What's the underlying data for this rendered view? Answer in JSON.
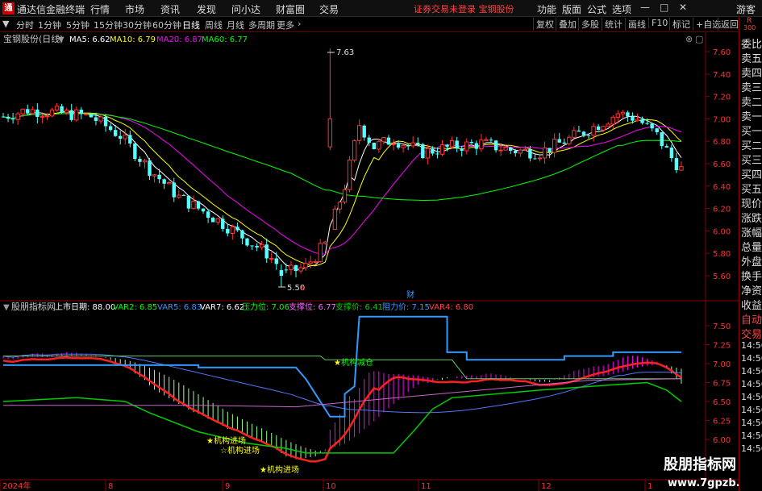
{
  "titlebar": {
    "logo_text": "通",
    "app_title": "通达信金融终端",
    "menus": [
      "行情",
      "市场",
      "资讯",
      "发现",
      "问小达",
      "财富圈",
      "交易"
    ],
    "warning": "证券交易未登录  宝钢股份",
    "right_menus": [
      "功能",
      "版面",
      "公式",
      "选项"
    ],
    "guest_label": "游客"
  },
  "toolbar": {
    "periods": [
      "分时",
      "1分钟",
      "5分钟",
      "15分钟",
      "30分钟",
      "60分钟",
      "日线",
      "周线",
      "月线",
      "多周期",
      "更多"
    ],
    "active_period": "日线",
    "right_buttons": [
      "复权",
      "叠加",
      "多股",
      "统计",
      "画线",
      "F10",
      "标记",
      "+自选",
      "返回"
    ]
  },
  "main_chart": {
    "stock_label": "宝钢股份(日线)",
    "ma_items": [
      {
        "label": "MA5: 6.62",
        "color": "#ffffff"
      },
      {
        "label": "MA10: 6.79",
        "color": "#ffff00"
      },
      {
        "label": "MA20: 6.87",
        "color": "#ff00ff"
      },
      {
        "label": "MA60: 6.77",
        "color": "#00ff00"
      }
    ],
    "y_ticks": [
      "7.60",
      "7.40",
      "7.20",
      "7.00",
      "6.80",
      "6.60",
      "6.40",
      "6.20",
      "6.00",
      "5.80",
      "5.60"
    ],
    "high_label": "7.63",
    "low_label": "5.50",
    "marker_s": "s",
    "marker_cai": "财"
  },
  "sub_chart": {
    "indicator_label": "股朋指标网",
    "items": [
      {
        "label": "上市日期: 88.00",
        "color": "#ffffff"
      },
      {
        "label": "VAR2: 6.85",
        "color": "#00ff00"
      },
      {
        "label": "VAR5: 6.83",
        "color": "#3399ff"
      },
      {
        "label": "VAR7: 6.62",
        "color": "#ffffff"
      },
      {
        "label": "压力位: 7.06",
        "color": "#00ff00"
      },
      {
        "label": "支撑位: 6.77",
        "color": "#ff66ff"
      },
      {
        "label": "支撑价: 6.41",
        "color": "#00cc00"
      },
      {
        "label": "阻力价: 7.15",
        "color": "#3399ff"
      },
      {
        "label": "VAR4: 6.80",
        "color": "#ff4040"
      }
    ],
    "y_ticks": [
      "7.50",
      "7.25",
      "7.00",
      "6.75",
      "6.50",
      "6.25",
      "6.00"
    ],
    "annotations": [
      "机构减仓",
      "机构进场",
      "机构进场",
      "机构进场"
    ]
  },
  "x_axis": {
    "labels": [
      "2024年",
      "8",
      "9",
      "10",
      "11",
      "12",
      "1"
    ]
  },
  "rightbar": {
    "top_label": "R",
    "top_sub": "300",
    "items": [
      "委比",
      "卖五",
      "卖四",
      "卖三",
      "卖二",
      "卖一",
      "买一",
      "买二",
      "买三",
      "买四",
      "买五",
      "现价",
      "涨跌",
      "涨幅",
      "总量",
      "外盘",
      "换手",
      "净资",
      "收益",
      "自动",
      "交易",
      "14:56",
      "14:56",
      "14:56",
      "14:56",
      "14:56",
      "14:56",
      "14:56",
      "14:56",
      "14:56"
    ]
  },
  "watermark": {
    "line1": "股朋指标网",
    "line2": "www.7gpzb.com"
  },
  "colors": {
    "up": "#ff3232",
    "down": "#54ffff",
    "ma5": "#ffffff",
    "ma10": "#ffff00",
    "ma20": "#ff00ff",
    "ma60": "#00ff00",
    "border": "#8a0000"
  }
}
